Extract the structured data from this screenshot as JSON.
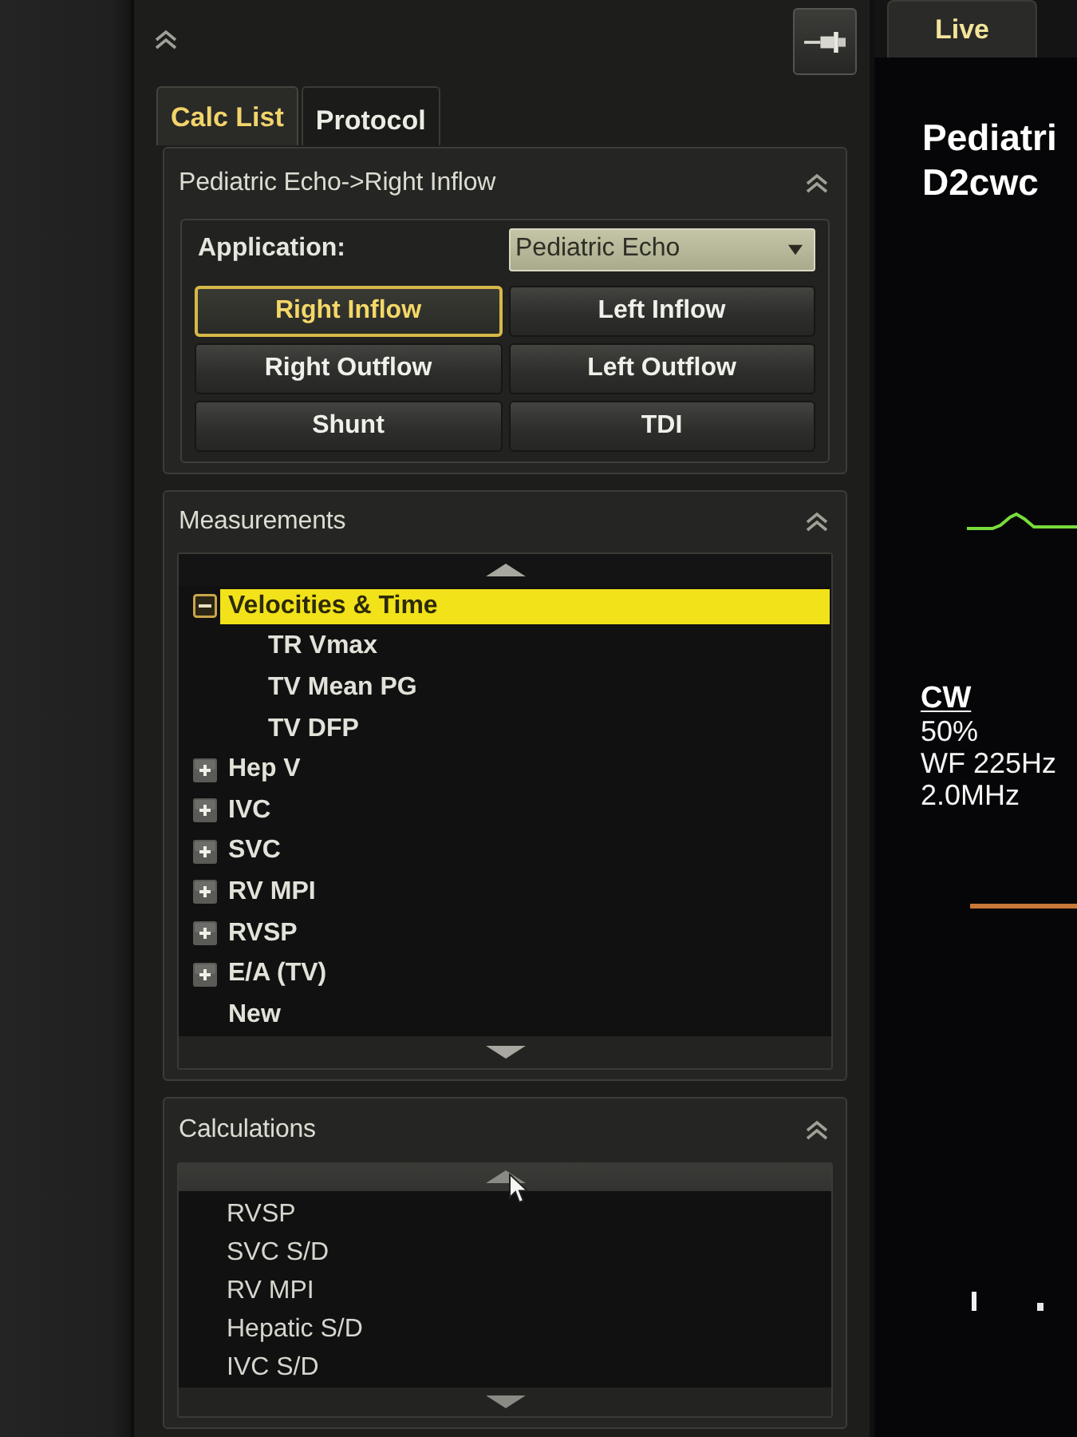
{
  "tabs": [
    {
      "label": "Calc List",
      "selected": true
    },
    {
      "label": "Protocol",
      "selected": false
    }
  ],
  "protocol": {
    "title": "Pediatric Echo->Right Inflow",
    "application": {
      "label": "Application:",
      "value": "Pediatric Echo"
    },
    "buttons": [
      {
        "label": "Right Inflow",
        "selected": true
      },
      {
        "label": "Left Inflow",
        "selected": false
      },
      {
        "label": "Right Outflow",
        "selected": false
      },
      {
        "label": "Left Outflow",
        "selected": false
      },
      {
        "label": "Shunt",
        "selected": false
      },
      {
        "label": "TDI",
        "selected": false
      }
    ]
  },
  "measurements": {
    "title": "Measurements",
    "items": [
      {
        "label": "Velocities & Time",
        "kind": "group",
        "expanded": true,
        "selected": true,
        "children": [
          {
            "label": "TR Vmax",
            "selected": false
          },
          {
            "label": "TV Mean PG",
            "selected": false
          },
          {
            "label": "TV DFP",
            "selected": false
          }
        ]
      },
      {
        "label": "Hep V",
        "kind": "group",
        "expanded": false,
        "selected": false
      },
      {
        "label": "IVC",
        "kind": "group",
        "expanded": false,
        "selected": false
      },
      {
        "label": "SVC",
        "kind": "group",
        "expanded": false,
        "selected": false
      },
      {
        "label": "RV MPI",
        "kind": "group",
        "expanded": false,
        "selected": false
      },
      {
        "label": "RVSP",
        "kind": "group",
        "expanded": false,
        "selected": false
      },
      {
        "label": "E/A (TV)",
        "kind": "group",
        "expanded": false,
        "selected": false
      },
      {
        "label": "New",
        "kind": "item",
        "selected": false
      }
    ]
  },
  "calculations": {
    "title": "Calculations",
    "items": [
      "RVSP",
      "SVC S/D",
      "RV MPI",
      "Hepatic S/D",
      "IVC S/D"
    ]
  },
  "image_view": {
    "tabs": [
      {
        "label": "Live",
        "selected": true
      }
    ],
    "title_lines": [
      "Pediatri",
      "D2cwc"
    ],
    "mode": "CW",
    "settings": [
      "50%",
      "WF 225Hz",
      "2.0MHz"
    ]
  }
}
